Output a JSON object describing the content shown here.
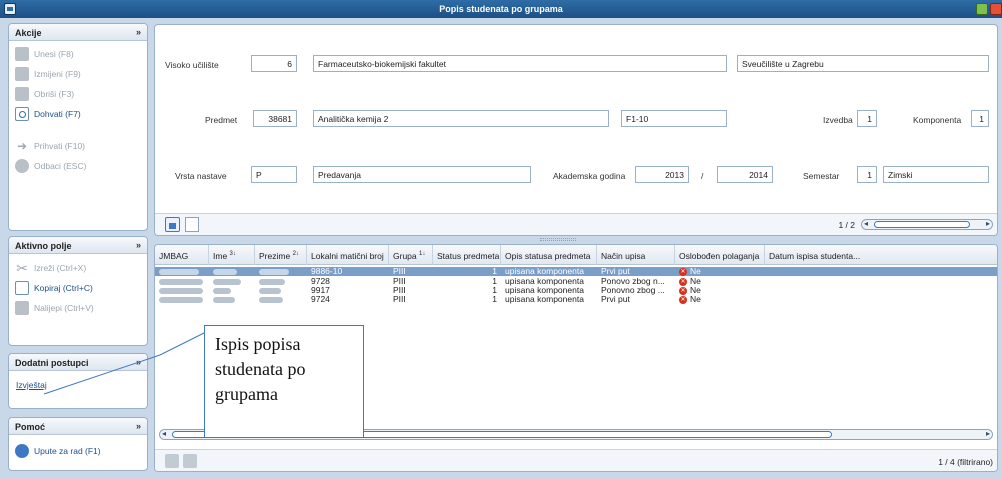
{
  "window": {
    "title": "Popis studenata po grupama"
  },
  "sidebar": {
    "akcije": {
      "title": "Akcije",
      "items": [
        {
          "label": "Unesi (F8)",
          "icon": "add-record-icon",
          "enabled": false
        },
        {
          "label": "Izmijeni (F9)",
          "icon": "edit-record-icon",
          "enabled": false
        },
        {
          "label": "Obriši (F3)",
          "icon": "delete-record-icon",
          "enabled": false
        },
        {
          "label": "Dohvati (F7)",
          "icon": "search-icon",
          "enabled": true
        },
        {
          "label": "Prihvati (F10)",
          "icon": "accept-arrow-icon",
          "enabled": false
        },
        {
          "label": "Odbaci (ESC)",
          "icon": "cancel-icon",
          "enabled": false
        }
      ]
    },
    "aktivno_polje": {
      "title": "Aktivno polje",
      "items": [
        {
          "label": "Izreži (Ctrl+X)",
          "icon": "cut-icon",
          "enabled": false
        },
        {
          "label": "Kopiraj (Ctrl+C)",
          "icon": "copy-icon",
          "enabled": true
        },
        {
          "label": "Nalijepi (Ctrl+V)",
          "icon": "paste-icon",
          "enabled": false
        }
      ]
    },
    "dodatni": {
      "title": "Dodatni postupci",
      "link": "Izvještaj"
    },
    "pomoc": {
      "title": "Pomoć",
      "item": "Upute za rad (F1)"
    },
    "collapse_glyph": "»"
  },
  "form": {
    "visoko_uciliste_label": "Visoko učilište",
    "visoko_uciliste_code": "6",
    "visoko_uciliste_name": "Farmaceutsko-biokemijski fakultet",
    "sveuciliste": "Sveučilište u Zagrebu",
    "predmet_label": "Predmet",
    "predmet_code": "38681",
    "predmet_name": "Analitička kemija 2",
    "predmet_oznaka": "F1-10",
    "izvedba_label": "Izvedba",
    "izvedba": "1",
    "komponenta_label": "Komponenta",
    "komponenta": "1",
    "vrsta_nastave_label": "Vrsta nastave",
    "vrsta_nastave_code": "P",
    "vrsta_nastave_name": "Predavanja",
    "akademska_godina_label": "Akademska godina",
    "godina_od": "2013",
    "godina_sep": "/",
    "godina_do": "2014",
    "semestar_label": "Semestar",
    "semestar": "1",
    "semestar_name": "Zimski",
    "pager": "1 / 2"
  },
  "grid": {
    "columns": [
      {
        "label": "JMBAG",
        "sup": ""
      },
      {
        "label": "Ime",
        "sup": "3↓"
      },
      {
        "label": "Prezime",
        "sup": "2↓"
      },
      {
        "label": "Lokalni matični broj",
        "sup": ""
      },
      {
        "label": "Grupa",
        "sup": "1↓"
      },
      {
        "label": "Status predmeta",
        "sup": ""
      },
      {
        "label": "Opis statusa predmeta",
        "sup": ""
      },
      {
        "label": "Način upisa",
        "sup": ""
      },
      {
        "label": "Oslobođen polaganja",
        "sup": ""
      },
      {
        "label": "Datum ispisa studenta...",
        "sup": ""
      }
    ],
    "rows": [
      {
        "lmb": "9886-10",
        "grupa": "PIII",
        "status": "1",
        "opis": "upisana komponenta",
        "nacin": "Prvi put",
        "osl": "Ne",
        "selected": true
      },
      {
        "lmb": "9728",
        "grupa": "PIII",
        "status": "1",
        "opis": "upisana komponenta",
        "nacin": "Ponovo zbog n...",
        "osl": "Ne",
        "selected": false
      },
      {
        "lmb": "9917",
        "grupa": "PIII",
        "status": "1",
        "opis": "upisana komponenta",
        "nacin": "Ponovno zbog ...",
        "osl": "Ne",
        "selected": false
      },
      {
        "lmb": "9724",
        "grupa": "PIII",
        "status": "1",
        "opis": "upisana komponenta",
        "nacin": "Prvi put",
        "osl": "Ne",
        "selected": false
      }
    ],
    "footer": "1 / 4 (filtrirano)"
  },
  "callout": {
    "line1": "Ispis popisa",
    "line2": "studenata po",
    "line3": "grupama"
  }
}
